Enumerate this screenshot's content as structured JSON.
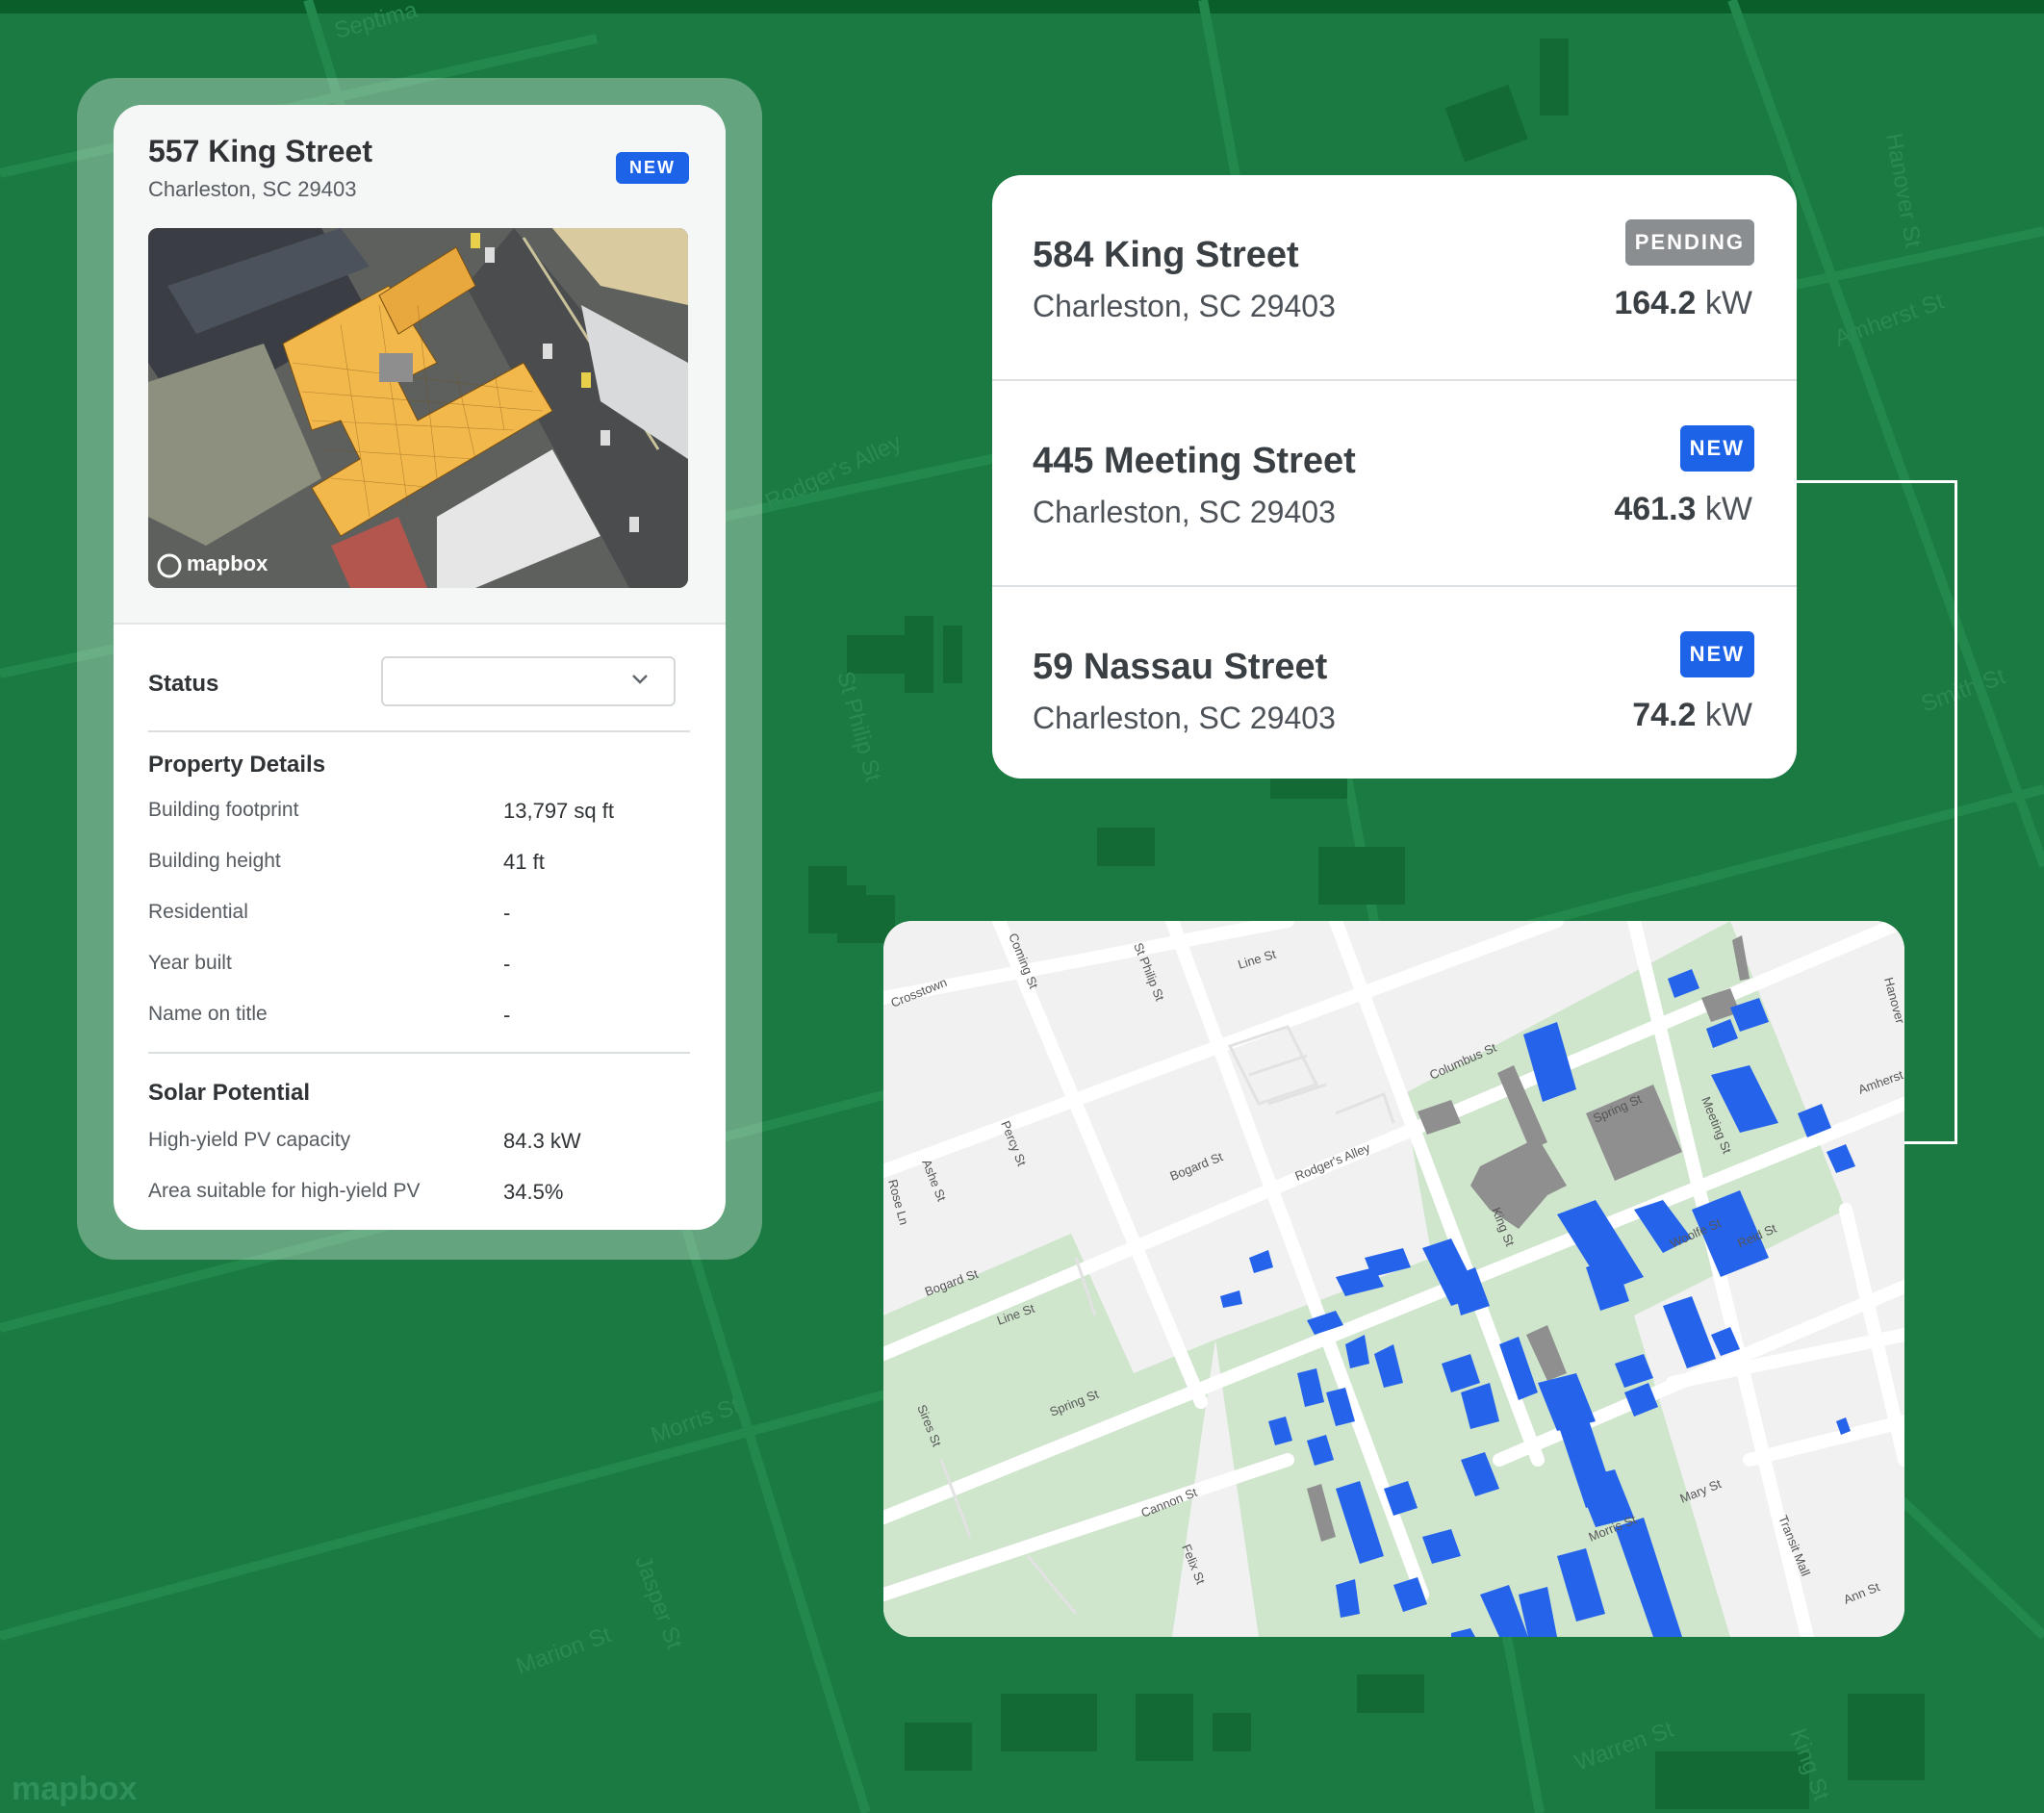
{
  "detail": {
    "title": "557 King Street",
    "subtitle": "Charleston, SC 29403",
    "badge": "NEW",
    "image_attribution": "mapbox",
    "status_label": "Status",
    "status_value": "",
    "sections": [
      {
        "title": "Property Details",
        "rows": [
          {
            "label": "Building footprint",
            "value": "13,797 sq ft"
          },
          {
            "label": "Building height",
            "value": "41 ft"
          },
          {
            "label": "Residential",
            "value": "-"
          },
          {
            "label": "Year built",
            "value": "-"
          },
          {
            "label": "Name on title",
            "value": "-"
          }
        ]
      },
      {
        "title": "Solar Potential",
        "rows": [
          {
            "label": "High-yield PV capacity",
            "value": "84.3 kW"
          },
          {
            "label": "Area suitable for high-yield PV",
            "value": "34.5%"
          }
        ]
      }
    ]
  },
  "properties": [
    {
      "name": "584 King Street",
      "city": "Charleston, SC 29403",
      "badge": "PENDING",
      "kw_value": "164.2",
      "kw_unit": "kW"
    },
    {
      "name": "445 Meeting Street",
      "city": "Charleston, SC 29403",
      "badge": "NEW",
      "kw_value": "461.3",
      "kw_unit": "kW"
    },
    {
      "name": "59 Nassau Street",
      "city": "Charleston, SC 29403",
      "badge": "NEW",
      "kw_value": "74.2",
      "kw_unit": "kW"
    }
  ],
  "street_map": {
    "labels": [
      "Line St",
      "Coming St",
      "St Philip St",
      "Bogard St",
      "Rodger's Alley",
      "Columbus St",
      "Spring St",
      "Meeting St",
      "King St",
      "Woolfe St",
      "Reid St",
      "Amherst",
      "Hanover",
      "Mary St",
      "Transit Mall",
      "Ann St",
      "Cannon St",
      "Felix St",
      "Sires St",
      "Percy St",
      "Ashe St",
      "Rose Ln",
      "Crosstown",
      "Morris St"
    ]
  },
  "background_labels": [
    "Septima",
    "Hanover St",
    "Amherst St",
    "Rodger's Alley",
    "St Philip St",
    "Smith St",
    "Morris St",
    "Marion St",
    "Jasper St",
    "Warren St",
    "King St",
    "mapbox"
  ],
  "colors": {
    "background": "#1b7a41",
    "badge_new": "#1d63e8",
    "badge_pending": "#8a8e91",
    "building_highlight": "#2563eb",
    "building_other": "#8f8f8f",
    "zone": "#cfe8cf"
  }
}
